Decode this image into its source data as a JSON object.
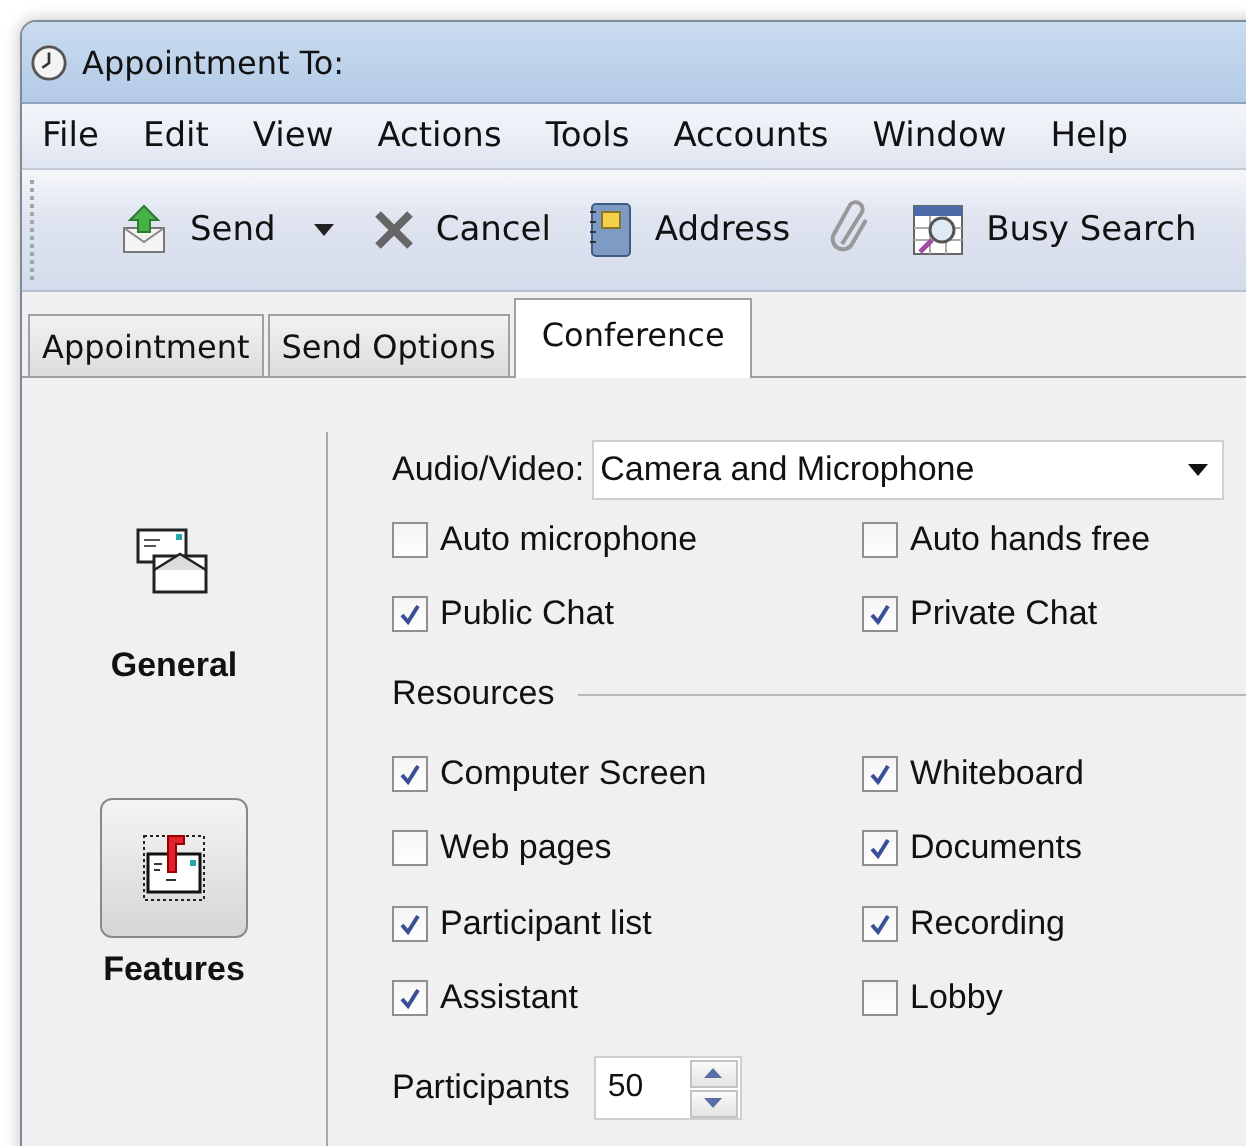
{
  "window": {
    "title": "Appointment To:"
  },
  "menu": [
    "File",
    "Edit",
    "View",
    "Actions",
    "Tools",
    "Accounts",
    "Window",
    "Help"
  ],
  "toolbar": [
    {
      "kind": "send",
      "label": "Send"
    },
    {
      "kind": "dropdown"
    },
    {
      "kind": "cancel",
      "label": "Cancel"
    },
    {
      "kind": "address",
      "label": "Address"
    },
    {
      "kind": "attach"
    },
    {
      "kind": "busy",
      "label": "Busy Search"
    }
  ],
  "tabs": [
    {
      "label": "Appointment",
      "selected": false
    },
    {
      "label": "Send Options",
      "selected": false
    },
    {
      "label": "Conference",
      "selected": true
    }
  ],
  "sections": [
    {
      "kind": "general",
      "label": "General",
      "selected": false
    },
    {
      "kind": "features",
      "label": "Features",
      "selected": true
    }
  ],
  "audio_video": {
    "label": "Audio/Video:",
    "value": "Camera and Microphone"
  },
  "options": [
    {
      "label": "Auto microphone",
      "checked": false
    },
    {
      "label": "Auto hands free",
      "checked": false
    },
    {
      "label": "Public Chat",
      "checked": true
    },
    {
      "label": "Private Chat",
      "checked": true
    }
  ],
  "resources": {
    "heading": "Resources",
    "items": [
      {
        "label": "Computer Screen",
        "checked": true
      },
      {
        "label": "Whiteboard",
        "checked": true
      },
      {
        "label": "Web pages",
        "checked": false
      },
      {
        "label": "Documents",
        "checked": true
      },
      {
        "label": "Participant list",
        "checked": true
      },
      {
        "label": "Recording",
        "checked": true
      },
      {
        "label": "Assistant",
        "checked": true
      },
      {
        "label": "Lobby",
        "checked": false
      }
    ]
  },
  "participants": {
    "label": "Participants",
    "value": "50"
  }
}
